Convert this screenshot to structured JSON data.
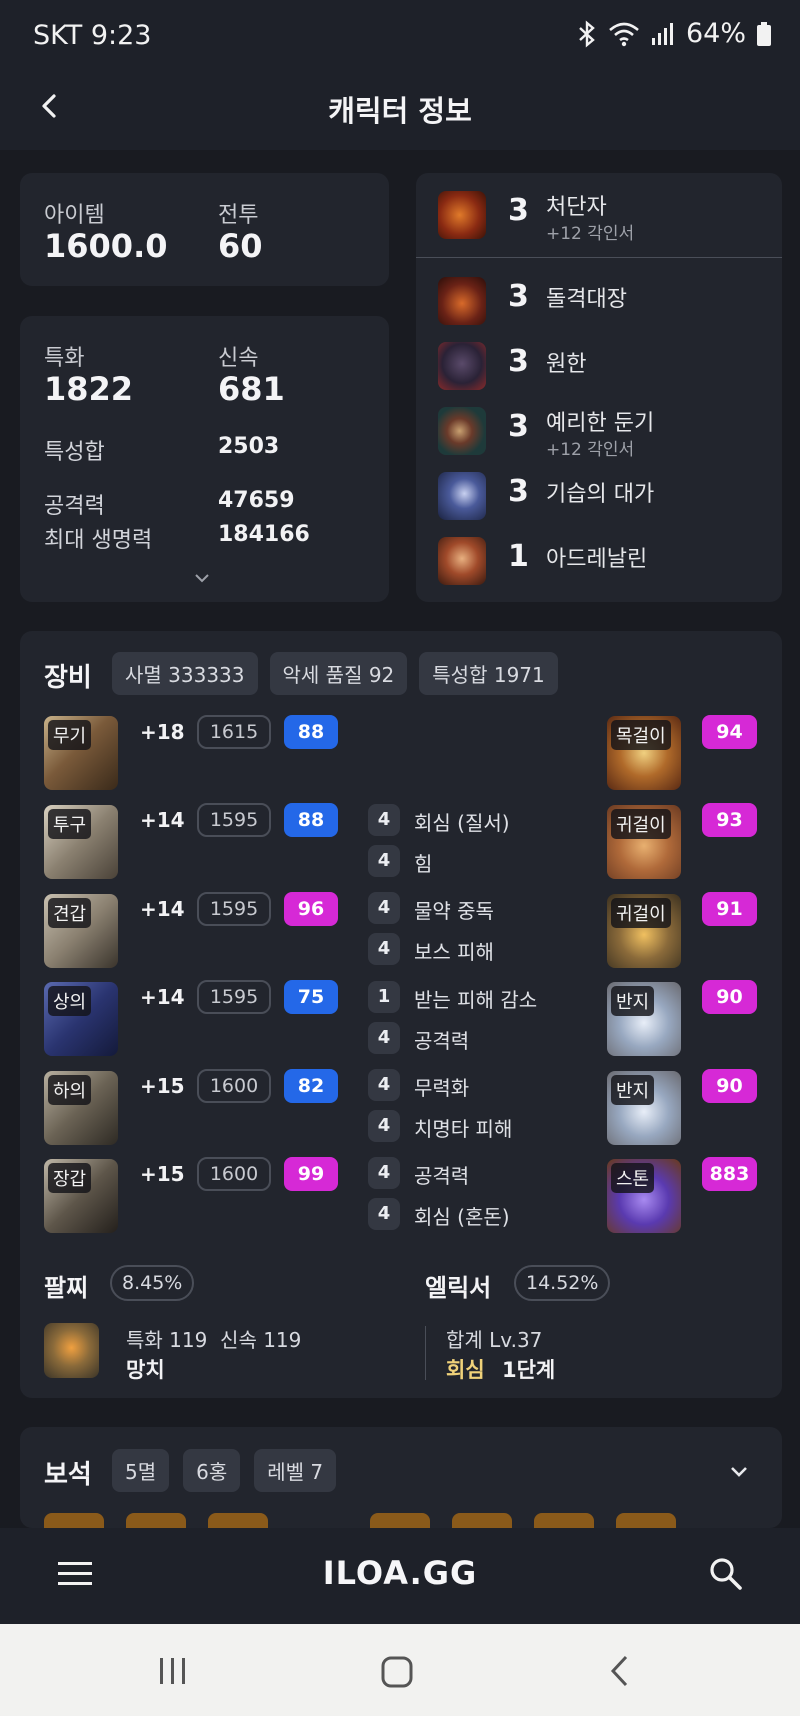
{
  "status_bar": {
    "carrier_time": "SKT 9:23",
    "battery": "64%"
  },
  "app_bar": {
    "title": "캐릭터 정보"
  },
  "summary": {
    "item_label": "아이템",
    "item_value": "1600.0",
    "combat_label": "전투",
    "combat_value": "60"
  },
  "stats": {
    "spec_label": "특화",
    "spec_value": "1822",
    "swift_label": "신속",
    "swift_value": "681",
    "total_label": "특성합",
    "total_value": "2503",
    "atk_label": "공격력",
    "atk_value": "47659",
    "hp_label": "최대 생명력",
    "hp_value": "184166"
  },
  "engravings": [
    {
      "level": "3",
      "name": "처단자",
      "sub": "+12 각인서"
    },
    {
      "level": "3",
      "name": "돌격대장",
      "sub": ""
    },
    {
      "level": "3",
      "name": "원한",
      "sub": ""
    },
    {
      "level": "3",
      "name": "예리한 둔기",
      "sub": "+12 각인서"
    },
    {
      "level": "3",
      "name": "기습의 대가",
      "sub": ""
    },
    {
      "level": "1",
      "name": "아드레날린",
      "sub": ""
    }
  ],
  "equipment": {
    "title": "장비",
    "chips": [
      "사멸 333333",
      "악세 품질 92",
      "특성합 1971"
    ],
    "gear": [
      {
        "slot": "무기",
        "honing": "+18",
        "ilvl": "1615",
        "quality": "88",
        "q_color": "#2468e8"
      },
      {
        "slot": "투구",
        "honing": "+14",
        "ilvl": "1595",
        "quality": "88",
        "q_color": "#2468e8"
      },
      {
        "slot": "견갑",
        "honing": "+14",
        "ilvl": "1595",
        "quality": "96",
        "q_color": "#d629d6"
      },
      {
        "slot": "상의",
        "honing": "+14",
        "ilvl": "1595",
        "quality": "75",
        "q_color": "#2468e8"
      },
      {
        "slot": "하의",
        "honing": "+15",
        "ilvl": "1600",
        "quality": "82",
        "q_color": "#2468e8"
      },
      {
        "slot": "장갑",
        "honing": "+15",
        "ilvl": "1600",
        "quality": "99",
        "q_color": "#d629d6"
      }
    ],
    "effects": [
      {
        "n": "4",
        "t": "회심 (질서)"
      },
      {
        "n": "4",
        "t": "힘"
      },
      {
        "n": "4",
        "t": "물약 중독"
      },
      {
        "n": "4",
        "t": "보스 피해"
      },
      {
        "n": "1",
        "t": "받는 피해 감소"
      },
      {
        "n": "4",
        "t": "공격력"
      },
      {
        "n": "4",
        "t": "무력화"
      },
      {
        "n": "4",
        "t": "치명타 피해"
      },
      {
        "n": "4",
        "t": "공격력"
      },
      {
        "n": "4",
        "t": "회심 (혼돈)"
      }
    ],
    "accessories": [
      {
        "slot": "목걸이",
        "quality": "94"
      },
      {
        "slot": "귀걸이",
        "quality": "93"
      },
      {
        "slot": "귀걸이",
        "quality": "91"
      },
      {
        "slot": "반지",
        "quality": "90"
      },
      {
        "slot": "반지",
        "quality": "90"
      },
      {
        "slot": "스톤",
        "quality": "883"
      }
    ],
    "bracelet": {
      "title": "팔찌",
      "pct": "8.45%",
      "line1": "특화 119  신속 119",
      "line2": "망치"
    },
    "elixir": {
      "title": "엘릭서",
      "pct": "14.52%",
      "line1": "합계 Lv.37",
      "line2_a": "회심",
      "line2_b": "1단계"
    }
  },
  "gems": {
    "title": "보석",
    "chips": [
      "5멸",
      "6홍",
      "레벨 7"
    ]
  },
  "bottom_nav": {
    "logo": "ILOA.GG"
  },
  "colors": {
    "bg": "#191b21",
    "card": "#22252d",
    "blue_quality": "#2468e8",
    "pink_quality": "#d629d6",
    "gold_text": "#f0d27a"
  }
}
